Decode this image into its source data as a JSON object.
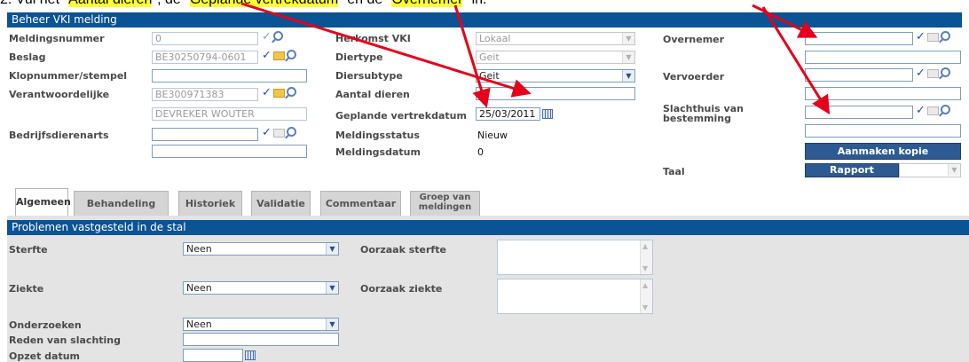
{
  "instruction": {
    "prefix": "2.   Vul het \"",
    "h1": "Aantal dieren",
    "mid1": "\", de \"",
    "h2": "Geplande vertrekdatum",
    "mid2": "\" en de \"",
    "h3": "Overnemer",
    "suffix": "\" in."
  },
  "header": {
    "title": "Beheer VKI melding"
  },
  "col1": {
    "meldingsnummer": {
      "label": "Meldingsnummer",
      "value": "0"
    },
    "beslag": {
      "label": "Beslag",
      "value": "BE30250794-0601"
    },
    "klopnummer": {
      "label": "Klopnummer/stempel",
      "value": ""
    },
    "verantwoordelijke": {
      "label": "Verantwoordelijke",
      "value": "BE300971383",
      "name": "DEVREKER WOUTER"
    },
    "bedrijfsdierenarts": {
      "label": "Bedrijfsdierenarts",
      "value": "",
      "value2": ""
    }
  },
  "col2": {
    "herkomst": {
      "label": "Herkomst VKI",
      "value": "Lokaal"
    },
    "diertype": {
      "label": "Diertype",
      "value": "Geit"
    },
    "diersubtype": {
      "label": "Diersubtype",
      "value": "Geit"
    },
    "aantal": {
      "label": "Aantal dieren",
      "value": ""
    },
    "vertrekdatum": {
      "label": "Geplande vertrekdatum",
      "value": "25/03/2011"
    },
    "status": {
      "label": "Meldingsstatus",
      "value": "Nieuw"
    },
    "meldingsdatum": {
      "label": "Meldingsdatum",
      "value": "0"
    }
  },
  "col3": {
    "overnemer": {
      "label": "Overnemer",
      "value": ""
    },
    "vervoerder": {
      "label": "Vervoerder",
      "value": ""
    },
    "slachthuis": {
      "label_line1": "Slachthuis van",
      "label_line2": "bestemming",
      "value": ""
    },
    "aanmaken_kopie": "Aanmaken kopie",
    "taal": {
      "label": "Taal",
      "button": "Rapport"
    }
  },
  "tabs": [
    {
      "label": "Algemeen",
      "active": true
    },
    {
      "label": "Behandeling"
    },
    {
      "label": "Historiek"
    },
    {
      "label": "Validatie"
    },
    {
      "label": "Commentaar"
    },
    {
      "label_line1": "Groep van",
      "label_line2": "meldingen"
    }
  ],
  "section": {
    "title": "Problemen vastgesteld in de stal",
    "sterfte": {
      "label": "Sterfte",
      "value": "Neen"
    },
    "oorzaak_sterfte": {
      "label": "Oorzaak sterfte",
      "value": ""
    },
    "ziekte": {
      "label": "Ziekte",
      "value": "Neen"
    },
    "oorzaak_ziekte": {
      "label": "Oorzaak ziekte",
      "value": ""
    },
    "onderzoeken": {
      "label": "Onderzoeken",
      "value": "Neen"
    },
    "reden": {
      "label": "Reden van slachting",
      "value": ""
    },
    "opzet": {
      "label": "Opzet datum",
      "value": ""
    }
  },
  "colors": {
    "header_bar": "#0a5394",
    "highlight": "#ffff33",
    "arrow": "#e5001b",
    "panel": "#e4e4e4"
  }
}
